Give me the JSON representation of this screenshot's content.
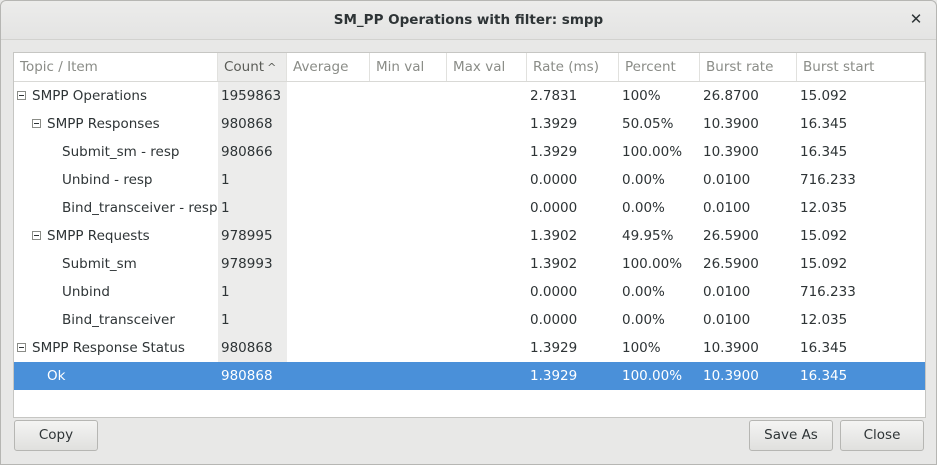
{
  "window": {
    "title": "SM_PP Operations with filter: smpp"
  },
  "columns": [
    {
      "key": "topic",
      "label": "Topic / Item"
    },
    {
      "key": "count",
      "label": "Count",
      "sorted": true,
      "sort_icon": "sort-ascending-icon"
    },
    {
      "key": "average",
      "label": "Average"
    },
    {
      "key": "min",
      "label": "Min val"
    },
    {
      "key": "max",
      "label": "Max val"
    },
    {
      "key": "rate",
      "label": "Rate (ms)"
    },
    {
      "key": "percent",
      "label": "Percent"
    },
    {
      "key": "burst_rate",
      "label": "Burst rate"
    },
    {
      "key": "burst_start",
      "label": "Burst start"
    }
  ],
  "rows": [
    {
      "topic": "SMPP Operations",
      "level": 0,
      "expandable": true,
      "expanded": true,
      "count": "1959863",
      "average": "",
      "min": "",
      "max": "",
      "rate": "2.7831",
      "percent": "100%",
      "burst_rate": "26.8700",
      "burst_start": "15.092"
    },
    {
      "topic": "SMPP Responses",
      "level": 1,
      "expandable": true,
      "expanded": true,
      "count": "980868",
      "average": "",
      "min": "",
      "max": "",
      "rate": "1.3929",
      "percent": "50.05%",
      "burst_rate": "10.3900",
      "burst_start": "16.345"
    },
    {
      "topic": "Submit_sm - resp",
      "level": 2,
      "expandable": false,
      "count": "980866",
      "average": "",
      "min": "",
      "max": "",
      "rate": "1.3929",
      "percent": "100.00%",
      "burst_rate": "10.3900",
      "burst_start": "16.345"
    },
    {
      "topic": "Unbind - resp",
      "level": 2,
      "expandable": false,
      "count": "1",
      "average": "",
      "min": "",
      "max": "",
      "rate": "0.0000",
      "percent": "0.00%",
      "burst_rate": "0.0100",
      "burst_start": "716.233"
    },
    {
      "topic": "Bind_transceiver - resp",
      "level": 2,
      "expandable": false,
      "count": "1",
      "average": "",
      "min": "",
      "max": "",
      "rate": "0.0000",
      "percent": "0.00%",
      "burst_rate": "0.0100",
      "burst_start": "12.035"
    },
    {
      "topic": "SMPP Requests",
      "level": 1,
      "expandable": true,
      "expanded": true,
      "count": "978995",
      "average": "",
      "min": "",
      "max": "",
      "rate": "1.3902",
      "percent": "49.95%",
      "burst_rate": "26.5900",
      "burst_start": "15.092"
    },
    {
      "topic": "Submit_sm",
      "level": 2,
      "expandable": false,
      "count": "978993",
      "average": "",
      "min": "",
      "max": "",
      "rate": "1.3902",
      "percent": "100.00%",
      "burst_rate": "26.5900",
      "burst_start": "15.092"
    },
    {
      "topic": "Unbind",
      "level": 2,
      "expandable": false,
      "count": "1",
      "average": "",
      "min": "",
      "max": "",
      "rate": "0.0000",
      "percent": "0.00%",
      "burst_rate": "0.0100",
      "burst_start": "716.233"
    },
    {
      "topic": "Bind_transceiver",
      "level": 2,
      "expandable": false,
      "count": "1",
      "average": "",
      "min": "",
      "max": "",
      "rate": "0.0000",
      "percent": "0.00%",
      "burst_rate": "0.0100",
      "burst_start": "12.035"
    },
    {
      "topic": "SMPP Response Status",
      "level": 0,
      "expandable": true,
      "expanded": true,
      "count": "980868",
      "average": "",
      "min": "",
      "max": "",
      "rate": "1.3929",
      "percent": "100%",
      "burst_rate": "10.3900",
      "burst_start": "16.345"
    },
    {
      "topic": "Ok",
      "level": 1,
      "expandable": false,
      "selected": true,
      "count": "980868",
      "average": "",
      "min": "",
      "max": "",
      "rate": "1.3929",
      "percent": "100.00%",
      "burst_rate": "10.3900",
      "burst_start": "16.345"
    }
  ],
  "buttons": {
    "copy": "Copy",
    "save_as": "Save As",
    "close": "Close"
  },
  "icons": {
    "close": "close-icon",
    "expander": "collapse-tree-icon"
  },
  "colors": {
    "selection": "#4a90d9",
    "sorted_column_bg": "#ececeb"
  }
}
